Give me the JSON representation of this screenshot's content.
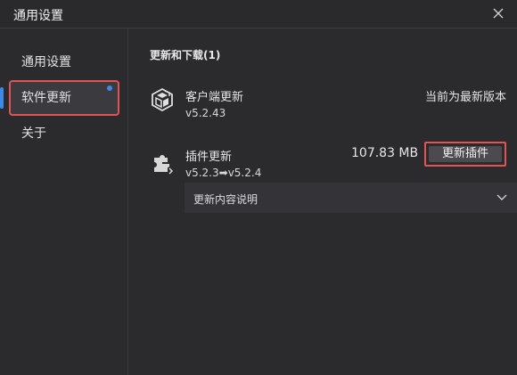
{
  "window": {
    "title": "通用设置",
    "close_icon": "close-icon"
  },
  "sidebar": {
    "items": [
      {
        "label": "通用设置",
        "active": false
      },
      {
        "label": "软件更新",
        "active": true,
        "has_dot": true
      },
      {
        "label": "关于",
        "active": false
      }
    ]
  },
  "main": {
    "section_title": "更新和下载(1)",
    "client": {
      "name": "客户端更新",
      "version": "v5.2.43",
      "status": "当前为最新版本",
      "icon": "cube-icon"
    },
    "plugin": {
      "name": "插件更新",
      "version": "v5.2.3➡v5.2.4",
      "size": "107.83 MB",
      "button": "更新插件",
      "icon": "puzzle-icon"
    },
    "changelog": {
      "label": "更新内容说明",
      "icon": "chevron-down-icon"
    }
  },
  "colors": {
    "accent": "#3c8ae8",
    "highlight": "#e25353",
    "background": "#2b2b2e"
  }
}
